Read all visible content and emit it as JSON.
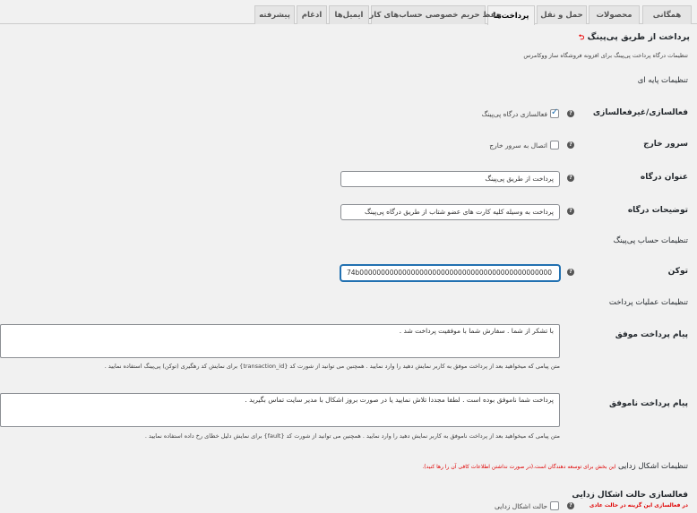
{
  "tabs": [
    {
      "label": "همگانی",
      "active": false
    },
    {
      "label": "محصولات",
      "active": false
    },
    {
      "label": "حمل و نقل",
      "active": false
    },
    {
      "label": "پرداخت‌ها",
      "active": true
    },
    {
      "label": "حفظ حریم خصوصی حساب‌های کاربری",
      "active": false
    },
    {
      "label": "ایمیل‌ها",
      "active": false
    },
    {
      "label": "ادغام",
      "active": false
    },
    {
      "label": "پیشرفته",
      "active": false
    }
  ],
  "page": {
    "title": "پرداخت از طریق پی‌پینگ",
    "title_link_arrow": "⮌",
    "description": "تنظیمات درگاه پرداخت پی‌پینگ برای افزونه فروشگاه ساز ووکامرس"
  },
  "basic": {
    "heading": "تنظیمات پایه ای",
    "enable": {
      "label": "فعالسازی/غیرفعالسازی",
      "checkbox_label": "فعالسازی درگاه پی‌پینگ",
      "checked": true
    },
    "external": {
      "label": "سرور خارج",
      "checkbox_label": "اتصال به سرور خارج",
      "checked": false
    },
    "gateway_title": {
      "label": "عنوان درگاه",
      "value": "پرداخت از طریق پی‌پینگ"
    },
    "gateway_desc": {
      "label": "توضیحات درگاه",
      "value": "پرداخت به وسیله کلیه کارت های عضو شتاب از طریق درگاه پی‌پینگ"
    }
  },
  "account": {
    "heading": "تنظیمات حساب پی‌پینگ",
    "token": {
      "label": "توکن",
      "value": "74b000000000000000000000000000000000000000000000"
    }
  },
  "operations": {
    "heading": "تنظیمات عملیات پرداخت",
    "success": {
      "label": "پیام پرداخت موفق",
      "value": "با تشکر از شما . سفارش شما با موفقیت پرداخت شد .",
      "help": "متن پیامی که میخواهید بعد از پرداخت موفق به کاربر نمایش دهید را وارد نمایید . همچنین می توانید از شورت کد {transaction_id} برای نمایش کد رهگیری (توکن) پی‌پینگ استفاده نمایید ."
    },
    "failed": {
      "label": "پیام پرداخت ناموفق",
      "value": "پرداخت شما ناموفق بوده است . لطفا مجددا تلاش نمایید یا در صورت بروز اشکال با مدیر سایت تماس بگیرید .",
      "help": "متن پیامی که میخواهید بعد از پرداخت ناموفق به کاربر نمایش دهید را وارد نمایید . همچنین می توانید از شورت کد {fault} برای نمایش دلیل خطای رخ داده استفاده نمایید ."
    }
  },
  "debug": {
    "heading": "تنظیمات اشکال زدایی",
    "heading_note": "این بخش برای توسعه دهندگان است.(در صورت نداشتن اطلاعات کافی آن را رها کنید).",
    "enable": {
      "label": "فعالسازی حالت اشکال زدایی",
      "sublabel": "در فعالسازی این گزینه در حالت عادی",
      "checkbox_label": "حالت اشکال زدایی",
      "checked": false
    }
  },
  "colors": {
    "accent": "#2271b1",
    "warning": "#e00000"
  }
}
